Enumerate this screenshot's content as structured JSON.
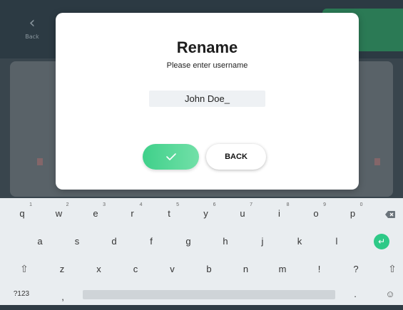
{
  "background": {
    "back_label": "Back"
  },
  "dialog": {
    "title": "Rename",
    "subtitle": "Please enter username",
    "name_value": "John Doe_",
    "ok_icon": "check-icon",
    "back_label": "BACK"
  },
  "keyboard": {
    "row1": [
      {
        "key": "q",
        "num": "1"
      },
      {
        "key": "w",
        "num": "2"
      },
      {
        "key": "e",
        "num": "3"
      },
      {
        "key": "r",
        "num": "4"
      },
      {
        "key": "t",
        "num": "5"
      },
      {
        "key": "y",
        "num": "6"
      },
      {
        "key": "u",
        "num": "7"
      },
      {
        "key": "i",
        "num": "8"
      },
      {
        "key": "o",
        "num": "9"
      },
      {
        "key": "p",
        "num": "0"
      }
    ],
    "row2": [
      "a",
      "s",
      "d",
      "f",
      "g",
      "h",
      "j",
      "k",
      "l"
    ],
    "row3": [
      "z",
      "x",
      "c",
      "v",
      "b",
      "n",
      "m",
      "!",
      "?"
    ],
    "symbols_label": "?123",
    "comma": ",",
    "period": ".",
    "icons": {
      "backspace": "backspace-icon",
      "enter": "enter-icon",
      "shift": "shift-icon",
      "emoji": "emoji-icon"
    }
  }
}
